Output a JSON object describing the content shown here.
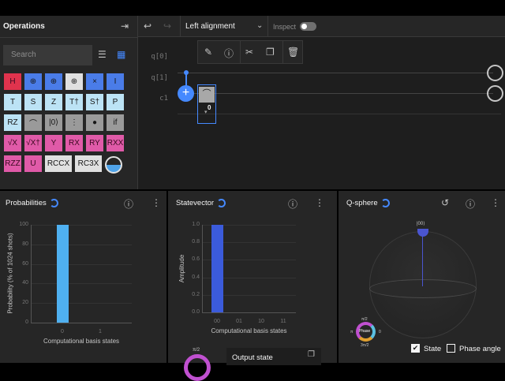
{
  "operations": {
    "title": "Operations",
    "search_placeholder": "Search",
    "gates": [
      {
        "label": "H",
        "color": "#e0334d"
      },
      {
        "label": "⊕",
        "color": "#4a7ce8"
      },
      {
        "label": "⊕",
        "color": "#4a7ce8"
      },
      {
        "label": "⊕",
        "color": "#e0e0e0"
      },
      {
        "label": "×",
        "color": "#4a7ce8"
      },
      {
        "label": "I",
        "color": "#4a7ce8"
      },
      {
        "label": "T",
        "color": "#bce3f5"
      },
      {
        "label": "S",
        "color": "#bce3f5"
      },
      {
        "label": "Z",
        "color": "#bce3f5"
      },
      {
        "label": "T†",
        "color": "#bce3f5"
      },
      {
        "label": "S†",
        "color": "#bce3f5"
      },
      {
        "label": "P",
        "color": "#bce3f5"
      },
      {
        "label": "RZ",
        "color": "#bce3f5"
      },
      {
        "label": "⌒",
        "color": "#9a9a9a"
      },
      {
        "label": "|0⟩",
        "color": "#9a9a9a"
      },
      {
        "label": "⋮",
        "color": "#9a9a9a"
      },
      {
        "label": "●",
        "color": "#9a9a9a"
      },
      {
        "label": "if",
        "color": "#9a9a9a"
      },
      {
        "label": "√X",
        "color": "#e05aa8"
      },
      {
        "label": "√X†",
        "color": "#e05aa8"
      },
      {
        "label": "Y",
        "color": "#e05aa8"
      },
      {
        "label": "RX",
        "color": "#e05aa8"
      },
      {
        "label": "RY",
        "color": "#e05aa8"
      },
      {
        "label": "RXX",
        "color": "#e05aa8"
      },
      {
        "label": "RZZ",
        "color": "#e05aa8"
      },
      {
        "label": "U",
        "color": "#e05aa8"
      },
      {
        "label": "RCCX",
        "color": "#e0e0e0"
      },
      {
        "label": "RC3X",
        "color": "#e0e0e0"
      }
    ]
  },
  "toolbar": {
    "alignment": "Left alignment",
    "inspect": "Inspect"
  },
  "circuit": {
    "qubits": [
      "q[0]",
      "q[1]"
    ],
    "classical": "c1",
    "measure_bit": "0"
  },
  "probabilities": {
    "title": "Probabilities",
    "chart_data": {
      "type": "bar",
      "categories": [
        "0",
        "1"
      ],
      "values": [
        100,
        0
      ],
      "ylabel": "Probability (% of 1024 shots)",
      "xlabel": "Computational basis states",
      "ylim": [
        0,
        100
      ],
      "yticks": [
        "100",
        "80",
        "60",
        "40",
        "20",
        "0"
      ],
      "color": "#4fb0f0"
    }
  },
  "statevector": {
    "title": "Statevector",
    "output_state": "Output state",
    "phase_top": "π/2",
    "chart_data": {
      "type": "bar",
      "categories": [
        "00",
        "01",
        "10",
        "11"
      ],
      "values": [
        1,
        0,
        0,
        0
      ],
      "ylabel": "Amplitude",
      "xlabel": "Computational basis states",
      "ylim": [
        0,
        1
      ],
      "yticks": [
        "1.0",
        "0.8",
        "0.6",
        "0.4",
        "0.2",
        "0.0"
      ],
      "color": "#3b5bdb"
    }
  },
  "qsphere": {
    "title": "Q-sphere",
    "state_label": "|00⟩",
    "phase": {
      "center": "Phase",
      "top": "π/2",
      "left": "π",
      "right": "0",
      "bottom": "3π/2"
    },
    "state_checkbox": "State",
    "state_checked": true,
    "phase_angle_checkbox": "Phase angle",
    "phase_angle_checked": false
  }
}
